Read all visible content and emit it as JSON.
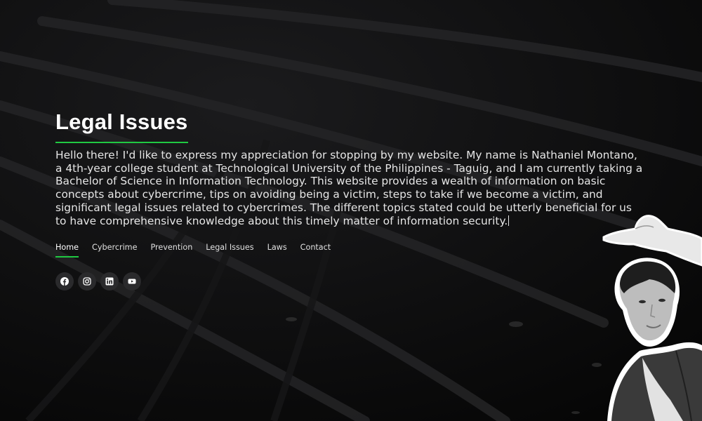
{
  "page": {
    "title": "Legal Issues",
    "intro": "Hello there! I'd like to express my appreciation for stopping by my website. My name is Nathaniel Montano, a 4th-year college student at Technological University of the Philippines - Taguig, and I am currently taking a Bachelor of Science in Information Technology. This website provides a wealth of information on basic concepts about cybercrime, tips on avoiding being a victim, steps to take if we become a victim, and significant legal issues related to cybercrimes. The different topics stated could be utterly beneficial for us to have comprehensive knowledge about this timely matter of information security."
  },
  "nav": {
    "home": "Home",
    "cybercrime": "Cybercrime",
    "prevention": "Prevention",
    "legal_issues": "Legal Issues",
    "laws": "Laws",
    "contact": "Contact"
  },
  "social": [
    "facebook-icon",
    "instagram-icon",
    "linkedin-icon",
    "youtube-icon"
  ],
  "colors": {
    "accent": "#20c942",
    "background": "#0b0b0c",
    "text": "#e6e6e6",
    "icon_bg": "#2a2a2c"
  }
}
